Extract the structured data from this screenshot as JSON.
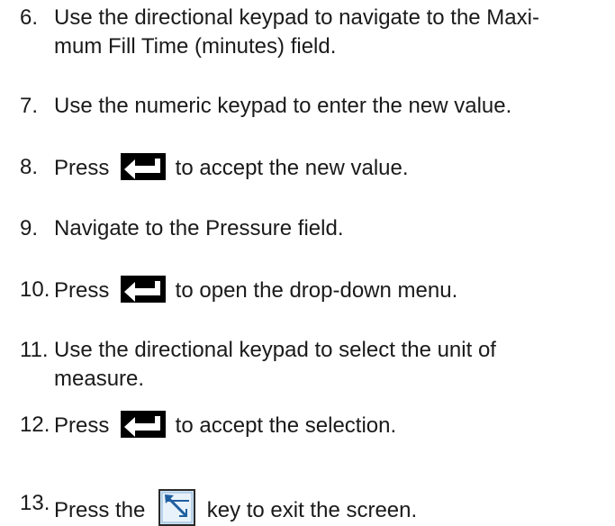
{
  "steps": [
    {
      "num": "6.",
      "lines": [
        "Use the directional keypad to navigate to the Maxi-",
        "mum Fill Time (minutes) field."
      ]
    },
    {
      "num": "7.",
      "lines": [
        "Use the numeric keypad to enter the new value."
      ]
    },
    {
      "num": "8.",
      "before": "Press ",
      "icon": "enter-key-icon",
      "after": " to accept the new value."
    },
    {
      "num": "9.",
      "lines": [
        "Navigate to the Pressure field."
      ]
    },
    {
      "num": "10.",
      "before": "Press ",
      "icon": "enter-key-icon",
      "after": " to open the drop-down menu."
    },
    {
      "num": "11.",
      "lines": [
        "Use the directional keypad to select the unit of",
        "measure."
      ]
    },
    {
      "num": "12.",
      "before": "Press ",
      "icon": "enter-key-icon",
      "after": " to accept the selection."
    },
    {
      "num": "13.",
      "before": "Press the ",
      "icon": "exit-screen-key-icon",
      "after": " key to exit the screen."
    }
  ],
  "colors": {
    "text": "#1a1a1a",
    "enter_key_bg": "#000000",
    "enter_key_arrow": "#ffffff",
    "exit_key_border": "#2a2a2a",
    "exit_key_fill": "#cfe3f3",
    "exit_key_arrow": "#1f5fa0"
  }
}
